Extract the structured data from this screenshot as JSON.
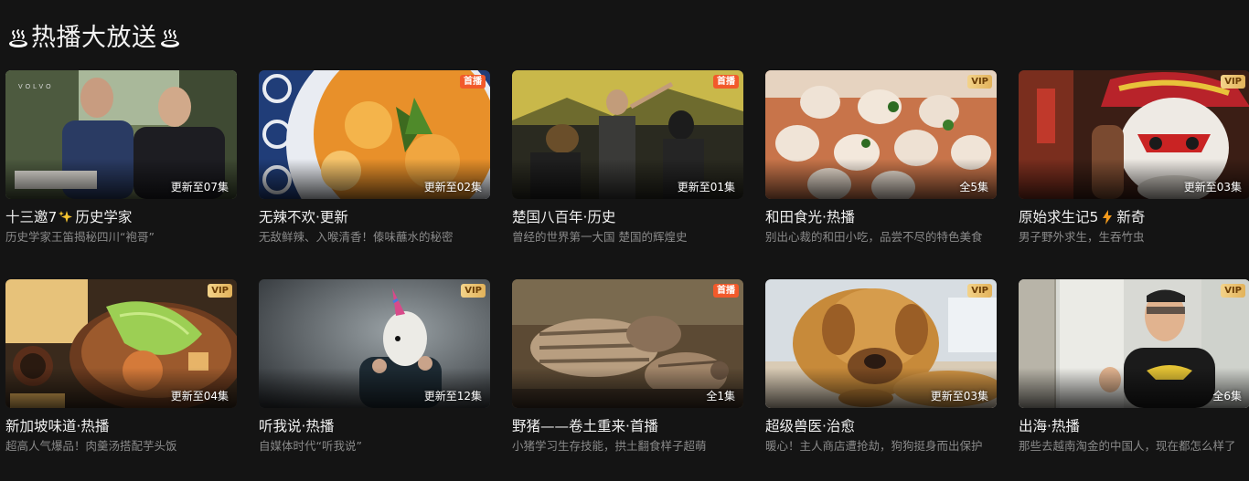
{
  "section": {
    "title": "热播大放送",
    "icon": "hot-spring-icon"
  },
  "colors": {
    "background": "#141414",
    "vip_badge": "#e8bb62",
    "first_badge": "#f25a2b",
    "subtitle": "#8a8a8a"
  },
  "cards": [
    {
      "title": "十三邀7",
      "title_icon": "sparkles-icon",
      "title_suffix": "历史学家",
      "subtitle": "历史学家王笛揭秘四川“袍哥”",
      "episode": "更新至07集",
      "badge": ""
    },
    {
      "title": "无辣不欢·更新",
      "subtitle": "无敌鲜辣、入喉清香！傣味蘸水的秘密",
      "episode": "更新至02集",
      "badge": "首播"
    },
    {
      "title": "楚国八百年·历史",
      "subtitle": "曾经的世界第一大国 楚国的辉煌史",
      "episode": "更新至01集",
      "badge": "首播"
    },
    {
      "title": "和田食光·热播",
      "subtitle": "别出心裁的和田小吃，品尝不尽的特色美食",
      "episode": "全5集",
      "badge": "VIP"
    },
    {
      "title": "原始求生记5",
      "title_icon": "lightning-icon",
      "title_suffix": "新奇",
      "subtitle": "男子野外求生，生吞竹虫",
      "episode": "更新至03集",
      "badge": "VIP"
    },
    {
      "title": "新加坡味道·热播",
      "subtitle": "超高人气爆品！肉羹汤搭配芋头饭",
      "episode": "更新至04集",
      "badge": "VIP"
    },
    {
      "title": "听我说·热播",
      "subtitle": "自媒体时代“听我说”",
      "episode": "更新至12集",
      "badge": "VIP"
    },
    {
      "title": "野猪——卷土重来·首播",
      "subtitle": "小猪学习生存技能，拱土翻食样子超萌",
      "episode": "全1集",
      "badge": "首播"
    },
    {
      "title": "超级兽医·治愈",
      "subtitle": "暖心！主人商店遭抢劫，狗狗挺身而出保护",
      "episode": "更新至03集",
      "badge": "VIP"
    },
    {
      "title": "出海·热播",
      "subtitle": "那些去越南淘金的中国人，现在都怎么样了",
      "episode": "全6集",
      "badge": "VIP"
    }
  ]
}
